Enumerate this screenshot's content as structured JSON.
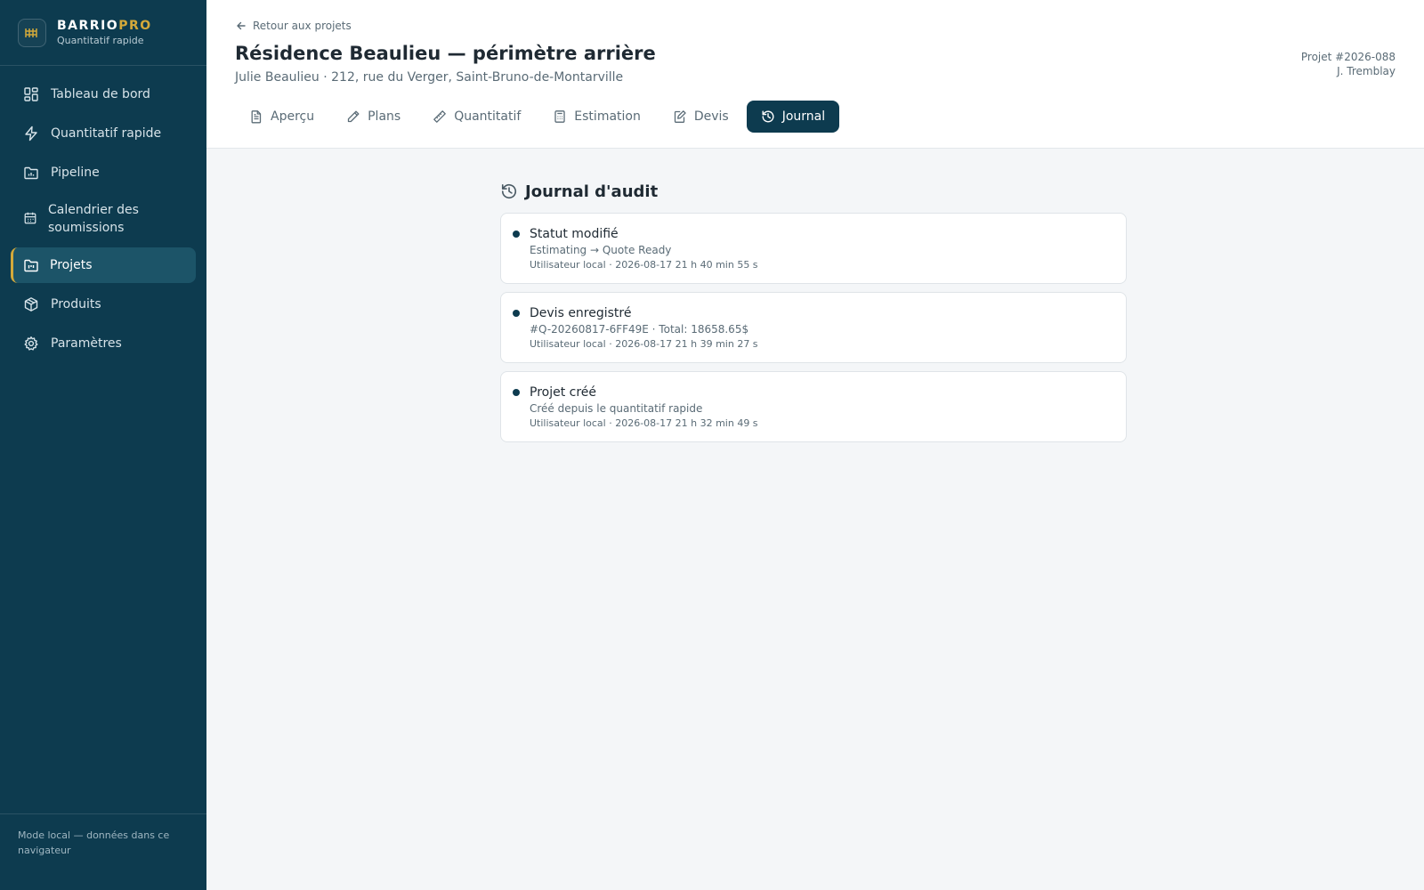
{
  "brand": {
    "name_main": "BARRIO",
    "name_accent": "PRO",
    "subtitle": "Quantitatif rapide",
    "accent_color": "#d4a93a",
    "sidebar_color": "#0d3b4f"
  },
  "sidebar": {
    "items": [
      {
        "label": "Tableau de bord",
        "icon": "dashboard-icon"
      },
      {
        "label": "Quantitatif rapide",
        "icon": "lightning-icon"
      },
      {
        "label": "Pipeline",
        "icon": "folder-chart-icon"
      },
      {
        "label": "Calendrier des soumissions",
        "icon": "calendar-icon"
      },
      {
        "label": "Projets",
        "icon": "folder-kanban-icon",
        "active": true
      },
      {
        "label": "Produits",
        "icon": "package-icon"
      },
      {
        "label": "Paramètres",
        "icon": "gear-icon"
      }
    ],
    "footer": "Mode local — données dans ce navigateur"
  },
  "header": {
    "back_label": "Retour aux projets",
    "title": "Résidence Beaulieu — périmètre arrière",
    "subtitle": "Julie Beaulieu · 212, rue du Verger, Saint-Bruno-de-Montarville",
    "project_number": "Projet #2026-088",
    "assignee": "J. Tremblay"
  },
  "tabs": [
    {
      "label": "Aperçu",
      "icon": "document-icon"
    },
    {
      "label": "Plans",
      "icon": "pencil-icon"
    },
    {
      "label": "Quantitatif",
      "icon": "ruler-icon"
    },
    {
      "label": "Estimation",
      "icon": "calculator-icon"
    },
    {
      "label": "Devis",
      "icon": "edit-document-icon"
    },
    {
      "label": "Journal",
      "icon": "history-icon",
      "active": true
    }
  ],
  "audit": {
    "title": "Journal d'audit",
    "entries": [
      {
        "title": "Statut modifié",
        "detail": "Estimating → Quote Ready",
        "meta": "Utilisateur local · 2026-08-17 21 h 40 min 55 s"
      },
      {
        "title": "Devis enregistré",
        "detail": "#Q-20260817-6FF49E · Total: 18658.65$",
        "meta": "Utilisateur local · 2026-08-17 21 h 39 min 27 s"
      },
      {
        "title": "Projet créé",
        "detail": "Créé depuis le quantitatif rapide",
        "meta": "Utilisateur local · 2026-08-17 21 h 32 min 49 s"
      }
    ]
  }
}
